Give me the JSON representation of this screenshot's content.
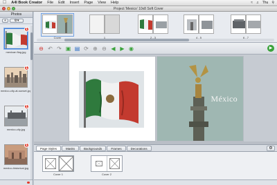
{
  "menubar": {
    "app_name": "A4I Book Creator",
    "items": [
      "File",
      "Edit",
      "Insert",
      "Page",
      "View",
      "Help"
    ],
    "status": "Thu"
  },
  "window": {
    "title": "Project 'Mexico' 10x8 Soft Cover"
  },
  "photos_panel": {
    "header": "Photos",
    "items": [
      {
        "label": "mexican flag.jpg",
        "badge": "1",
        "selected": true
      },
      {
        "label": "mexico-city-at-sunset.jpg",
        "badge": "1"
      },
      {
        "label": "mexico-city.jpg",
        "badge": "1"
      },
      {
        "label": "mexico-historical.jpg",
        "badge": "1"
      }
    ]
  },
  "page_strip": {
    "spreads": [
      {
        "caption": "Cover"
      },
      {
        "caption": "1"
      },
      {
        "caption": "2 - 3"
      },
      {
        "caption": "4 - 5"
      },
      {
        "caption": "6 - 7"
      }
    ]
  },
  "canvas": {
    "overlay_text": "México"
  },
  "tabs": {
    "items": [
      "Page Styles",
      "Masks",
      "Backgrounds",
      "Frames",
      "Decorations"
    ],
    "active": "Page Styles"
  },
  "layouts": [
    {
      "caption": "Cover 1"
    },
    {
      "caption": "Cover 2"
    }
  ],
  "colors": {
    "flag_green": "#2f7a3d",
    "flag_red": "#c33a2f",
    "accent_blue": "#3b7bd4",
    "badge_red": "#e23a2b"
  }
}
